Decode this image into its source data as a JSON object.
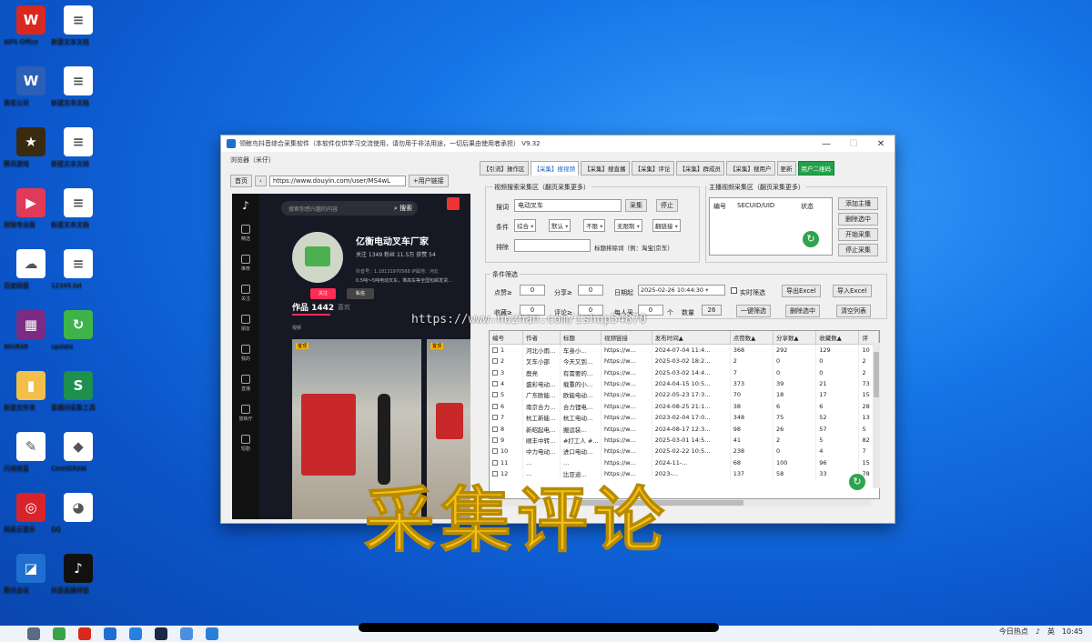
{
  "desktop": {
    "icons_col1": [
      {
        "label": "WPS Office",
        "glyph": "W",
        "color": "#d9281f"
      },
      {
        "label": "黄花公司",
        "glyph": "W",
        "color": "#2b5fb8"
      },
      {
        "label": "腾讯游戏",
        "glyph": "★",
        "color": "#3a2a10"
      },
      {
        "label": "剪映专业版",
        "glyph": "▶",
        "color": "#e03a58"
      },
      {
        "label": "百度网盘",
        "glyph": "☁",
        "color": "#ffffff"
      },
      {
        "label": "WinRAR",
        "glyph": "▦",
        "color": "#7a2c85"
      },
      {
        "label": "新建文件夹",
        "glyph": "▮",
        "color": "#f2c04a"
      },
      {
        "label": "闪退修复",
        "glyph": "✎",
        "color": "#ffffff"
      },
      {
        "label": "网易云音乐",
        "glyph": "◎",
        "color": "#d8232a"
      },
      {
        "label": "腾讯会议",
        "glyph": "◪",
        "color": "#1f6fd1"
      }
    ],
    "icons_col2": [
      {
        "label": "新建文本文档",
        "glyph": "≡",
        "color": "#ffffff"
      },
      {
        "label": "新建文本文档",
        "glyph": "≡",
        "color": "#ffffff"
      },
      {
        "label": "新建文本文档",
        "glyph": "≡",
        "color": "#ffffff"
      },
      {
        "label": "新建文本文档",
        "glyph": "≡",
        "color": "#ffffff"
      },
      {
        "label": "12345.txt",
        "glyph": "≡",
        "color": "#ffffff"
      },
      {
        "label": "update",
        "glyph": "↻",
        "color": "#3db34a"
      },
      {
        "label": "直播间采集工具",
        "glyph": "S",
        "color": "#1d8f4e"
      },
      {
        "label": "CorelDRAW",
        "glyph": "◆",
        "color": "#ffffff"
      },
      {
        "label": "QQ",
        "glyph": "◕",
        "color": "#ffffff"
      },
      {
        "label": "抖音直播伴侣",
        "glyph": "♪",
        "color": "#111111"
      }
    ]
  },
  "window": {
    "title": "领鲸鸟抖音综合采集软件（本软件仅供学习交流使用，请勿用于非法用途，一切后果由使用者承担）  V9.32",
    "controls": [
      "—",
      "☐",
      "✕"
    ],
    "browser_label": "浏览器（米仔）",
    "nav": {
      "home": "首页",
      "back": "‹",
      "url": "https://www.douyin.com/user/MS4wL",
      "add_user": "+用户链接"
    },
    "douyin": {
      "search_placeholder": "搜索你感兴趣的内容",
      "search_btn": "搜索",
      "name": "亿衡电动叉车厂家",
      "stats": "关注 1349   粉丝 11.5万   获赞 54",
      "meta": "抖音号：1.18131970568    IP属地：河北",
      "bio": "0.5吨～5吨电动叉车，堆高车等全国包邮发货…",
      "follow": "关注",
      "message": "私信",
      "works": "作品 1442",
      "likes": "喜欢",
      "tag": "视频",
      "pin": "置顶",
      "sidebar": [
        "精选",
        "推荐",
        "关注",
        "朋友",
        "我的",
        "直播",
        "放映厅",
        "短剧"
      ]
    },
    "tabs": [
      "【引流】操作区",
      "【采集】搜视频",
      "【采集】搜直播",
      "【采集】评论",
      "【采集】群成员",
      "【采集】搜用户",
      "更新",
      "用户二维码"
    ],
    "search_section": {
      "title": "视频搜索采集区（翻页采集更多）",
      "keyword_label": "搜词",
      "keyword_value": "电动叉车",
      "collect_btn": "采集",
      "stop_btn": "停止",
      "cond_label": "条件",
      "conds": [
        "综合",
        "默认",
        "不限",
        "无限制",
        "翻链接"
      ],
      "exclude_label": "排除",
      "exclude_hint": "标题排除词（例：淘宝|京东）"
    },
    "anchor_section": {
      "title": "主播视频采集区（翻页采集更多）",
      "col1": "编号",
      "col2": "SECUID/UID",
      "col3": "状态",
      "buttons": [
        "添加主播",
        "删除选中",
        "开始采集",
        "停止采集"
      ]
    },
    "filter_section": {
      "title": "条件筛选",
      "plays_label": "点赞≥",
      "plays_value": "0",
      "shares_label": "分享≥",
      "shares_value": "0",
      "date_label": "日期起",
      "date_value": "2025-02-26 10:44:30",
      "realtime": "实时筛选",
      "export": "导出Excel",
      "import": "导入Excel",
      "collect_label": "收藏≥",
      "collect_value": "0",
      "comment_label": "评论≥",
      "comment_value": "0",
      "each_label": "每人采",
      "each_value": "0",
      "each_unit": "个",
      "count_label": "数量",
      "count_value": "26",
      "one_key": "一键筛选",
      "delete_sel": "删除选中",
      "clear": "清空列表"
    },
    "table": {
      "headers": [
        "编号",
        "作者",
        "标题",
        "视频链接",
        "发布时间▲",
        "点赞数▲",
        "分享数▲",
        "收藏数▲",
        "评"
      ],
      "rows": [
        [
          "1",
          "河北小雨…",
          "车身小…",
          "https://w…",
          "2024-07-04 11:4…",
          "368",
          "292",
          "129",
          "10"
        ],
        [
          "2",
          "叉车小邵",
          "今天又到…",
          "https://w…",
          "2025-03-02 18:2…",
          "2",
          "0",
          "0",
          "2"
        ],
        [
          "3",
          "鹿亮",
          "有需要的…",
          "https://w…",
          "2025-03-02 14:4…",
          "7",
          "0",
          "0",
          "2"
        ],
        [
          "4",
          "盛彩电动…",
          "载重的小…",
          "https://w…",
          "2024-04-15 10:5…",
          "373",
          "39",
          "21",
          "73"
        ],
        [
          "5",
          "广东欧能…",
          "欧能电动…",
          "https://w…",
          "2022-05-23 17:3…",
          "70",
          "18",
          "17",
          "15"
        ],
        [
          "6",
          "南京合力…",
          "合力锂电…",
          "https://w…",
          "2024-08-25 21:1…",
          "38",
          "6",
          "6",
          "28"
        ],
        [
          "7",
          "杭工新能…",
          "杭工电动…",
          "https://w…",
          "2023-02-04 17:0…",
          "348",
          "75",
          "52",
          "13"
        ],
        [
          "8",
          "新昭起电…",
          "搬运装…",
          "https://w…",
          "2024-08-17 12:3…",
          "98",
          "26",
          "57",
          "5"
        ],
        [
          "9",
          "顺丰中转…",
          "#打工人 #…",
          "https://w…",
          "2025-03-01 14:5…",
          "41",
          "2",
          "5",
          "82"
        ],
        [
          "10",
          "中力电动…",
          "进口电动…",
          "https://w…",
          "2025-02-22 10:5…",
          "238",
          "0",
          "4",
          "7"
        ],
        [
          "11",
          "…",
          "…",
          "https://w…",
          "2024-11-…",
          "68",
          "100",
          "96",
          "15"
        ],
        [
          "12",
          "…",
          "比亚迪…",
          "https://w…",
          "2023-…",
          "137",
          "58",
          "33",
          "78"
        ]
      ]
    }
  },
  "overlay": {
    "watermark": "https://www.huzhan.com/ishop54870",
    "caption": "采集评论"
  },
  "taskbar": {
    "news": "今日热点",
    "ime": "英",
    "time": "10:45"
  }
}
